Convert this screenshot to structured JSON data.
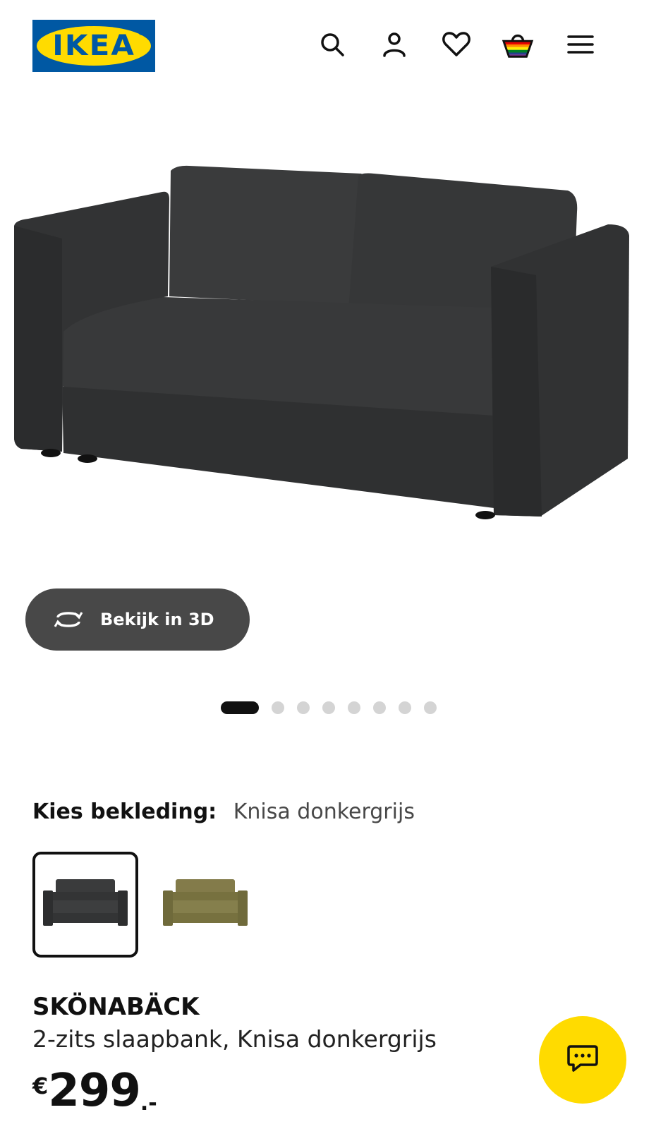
{
  "header": {
    "logo_text": "IKEA",
    "logo_reg": "®",
    "icons": [
      "search-icon",
      "account-icon",
      "heart-icon",
      "basket-icon",
      "menu-icon"
    ]
  },
  "hero": {
    "image": "sofa-bed-dark-grey",
    "view_3d_label": "Bekijk in 3D",
    "carousel": {
      "total": 8,
      "active": 1
    }
  },
  "options": {
    "label": "Kies bekleding:",
    "value": "Knisa donkergrijs",
    "swatches": [
      {
        "name": "dark-grey-sofa",
        "color": "#3a3b3c",
        "selected": true
      },
      {
        "name": "olive-sofa",
        "color": "#7d7744",
        "selected": false
      }
    ]
  },
  "product": {
    "name": "SKÖNABÄCK",
    "description": "2-zits slaapbank, Knisa donkergrijs",
    "price_currency": "€",
    "price_amount": "299",
    "price_decimal": ".-"
  },
  "colors": {
    "brand_blue": "#0058a3",
    "brand_yellow": "#ffdb00",
    "button_dark": "#484848"
  }
}
